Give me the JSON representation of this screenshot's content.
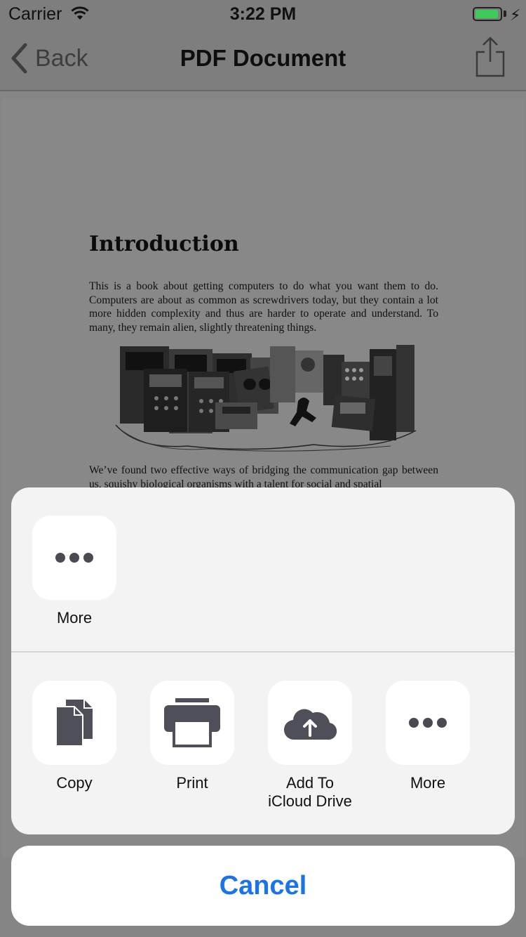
{
  "status_bar": {
    "carrier": "Carrier",
    "time": "3:22 PM"
  },
  "nav": {
    "back_label": "Back",
    "title": "PDF Document"
  },
  "pdf": {
    "heading": "Introduction",
    "paragraph1": "This is a book about getting computers to do what you want them to do. Computers are about as common as screwdrivers today, but they contain a lot more hidden complexity and thus are harder to operate and understand. To many, they remain alien, slightly threatening things.",
    "paragraph2": "We’ve found two effective ways of bridging the communication gap between us, squishy biological organisms with a talent for social and spatial"
  },
  "share_sheet": {
    "app_tiles": [
      {
        "label": "More",
        "icon": "more-dots-icon"
      }
    ],
    "action_tiles": [
      {
        "label": "Copy",
        "icon": "copy-icon"
      },
      {
        "label": "Print",
        "icon": "printer-icon"
      },
      {
        "label": "Add To\niCloud Drive",
        "icon": "icloud-upload-icon"
      },
      {
        "label": "More",
        "icon": "more-dots-icon"
      }
    ],
    "cancel_label": "Cancel"
  },
  "colors": {
    "accent": "#1a73e8",
    "battery": "#3dcc5a"
  }
}
